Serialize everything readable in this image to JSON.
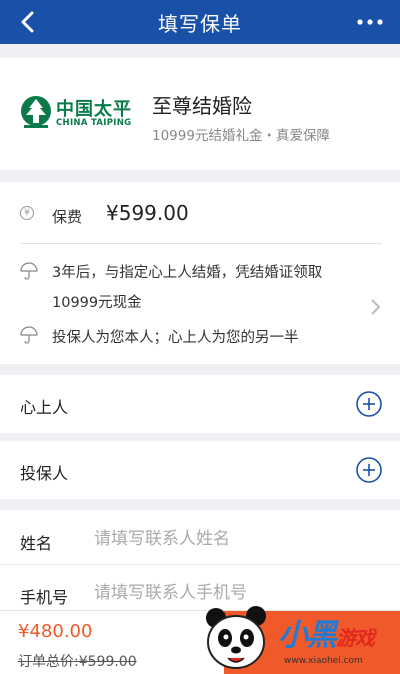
{
  "header": {
    "title": "填写保单",
    "back_icon": "chevron-left-icon",
    "more_icon": "more-dots-icon",
    "bg_color": "#1a51a8"
  },
  "product": {
    "logo_text_cn": "中国太平",
    "logo_text_en": "CHINA TAIPING",
    "name": "至尊结婚险",
    "description": "10999元结婚礼金・真爱保障"
  },
  "premium": {
    "icon": "yen-circle-icon",
    "label": "保费",
    "amount": "¥599.00",
    "benefits": [
      "3年后，与指定心上人结婚，凭结婚证领取10999元现金",
      "投保人为您本人；心上人为您的另一半"
    ]
  },
  "sections": {
    "sweetheart_label": "心上人",
    "policyholder_label": "投保人"
  },
  "contact": {
    "name_label": "姓名",
    "name_placeholder": "请填写联系人姓名",
    "phone_label": "手机号",
    "phone_placeholder": "请填写联系人手机号"
  },
  "footer": {
    "pay_price": "¥480.00",
    "total_label": "订单总价:",
    "total_price": "¥599.00",
    "accent_color": "#f05a2a"
  },
  "watermark": {
    "title_main": "小黑",
    "title_sub": "游戏",
    "url": "www.xiaohei.com"
  }
}
